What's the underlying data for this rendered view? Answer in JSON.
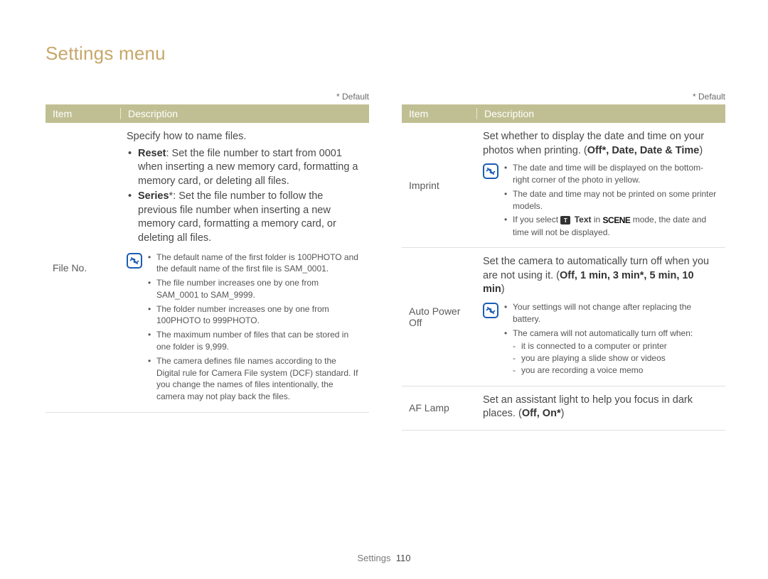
{
  "page_title": "Settings menu",
  "default_note": "* Default",
  "table_headers": {
    "item": "Item",
    "description": "Description"
  },
  "left": {
    "file_no": {
      "label": "File No.",
      "intro": "Specify how to name files.",
      "reset_label": "Reset",
      "reset_text": ": Set the file number to start from 0001 when inserting a new memory card, formatting a memory card, or deleting all files.",
      "series_label": "Series",
      "series_star": "*",
      "series_text": ": Set the file number to follow the previous file number when inserting a new memory card, formatting a memory card, or deleting all files.",
      "notes": [
        "The default name of the first folder is 100PHOTO and the default name of the first file is SAM_0001.",
        "The file number increases one by one from SAM_0001 to SAM_9999.",
        "The folder number increases one by one from 100PHOTO to 999PHOTO.",
        "The maximum number of files that can be stored in one folder is 9,999.",
        "The camera defines file names according to the Digital rule for Camera File system (DCF) standard. If you change the names of files intentionally, the camera may not play back the files."
      ]
    }
  },
  "right": {
    "imprint": {
      "label": "Imprint",
      "intro": "Set whether to display the date and time on your photos when printing. (",
      "opts": "Off*, Date, Date & Time",
      "intro_close": ")",
      "notes_pre": [
        "The date and time will be displayed on the bottom-right corner of the photo in yellow.",
        "The date and time may not be printed on some printer models."
      ],
      "note3_pre": "If you select ",
      "note3_text_label": "Text",
      "note3_mid": " in ",
      "note3_scene": "SCENE",
      "note3_post": " mode, the date and time will not be displayed."
    },
    "auto_power_off": {
      "label": "Auto Power Off",
      "intro": "Set the camera to automatically turn off when you are not using it. (",
      "opts": "Off, 1 min, 3 min*, 5 min, 10 min",
      "intro_close": ")",
      "note1": "Your settings will not change after replacing the battery.",
      "note2_lead": "The camera will not automatically turn off when:",
      "note2_subs": [
        "it is connected to a computer or printer",
        "you are playing a slide show or videos",
        "you are recording a voice memo"
      ]
    },
    "af_lamp": {
      "label": "AF Lamp",
      "intro": "Set an assistant light to help you focus in dark places. (",
      "opts": "Off, On*",
      "intro_close": ")"
    }
  },
  "footer": {
    "section": "Settings",
    "page": "110"
  },
  "icon_names": {
    "note": "note-icon",
    "text_mode": "text-mode-icon",
    "scene_mode": "scene-mode-icon"
  }
}
